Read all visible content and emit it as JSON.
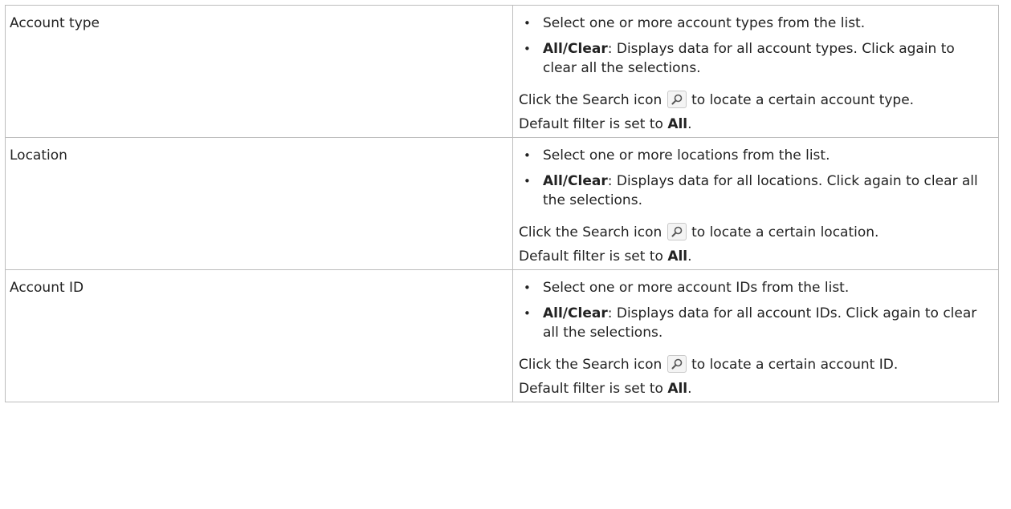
{
  "rows": [
    {
      "name": "Account type",
      "bullet1": "Select one or more account types from the list.",
      "bullet2_strong": "All/Clear",
      "bullet2_rest": ": Displays data for all account types. Click again to clear all the selections.",
      "search_prefix": "Click the Search icon",
      "search_suffix": "to locate a certain account type.",
      "default_prefix": "Default filter is set to",
      "default_value": "All",
      "default_suffix": "."
    },
    {
      "name": "Location",
      "bullet1": "Select one or more locations from the list.",
      "bullet2_strong": "All/Clear",
      "bullet2_rest": ": Displays data for all locations. Click again to clear all the selections.",
      "search_prefix": "Click the Search icon",
      "search_suffix": "to locate a certain location.",
      "default_prefix": "Default filter is set to",
      "default_value": "All",
      "default_suffix": "."
    },
    {
      "name": "Account ID",
      "bullet1": "Select one or more account IDs from the list.",
      "bullet2_strong": "All/Clear",
      "bullet2_rest": ": Displays data for all account IDs. Click again to clear all the selections.",
      "search_prefix": "Click the Search icon",
      "search_suffix": "to locate a certain account ID.",
      "default_prefix": "Default filter is set to",
      "default_value": "All",
      "default_suffix": "."
    }
  ],
  "bullet_char": "•",
  "icons": {
    "search": "search-icon"
  },
  "colors": {
    "border": "#bdbdbd",
    "text": "#222222",
    "icon_bg": "#f4f4f4"
  }
}
